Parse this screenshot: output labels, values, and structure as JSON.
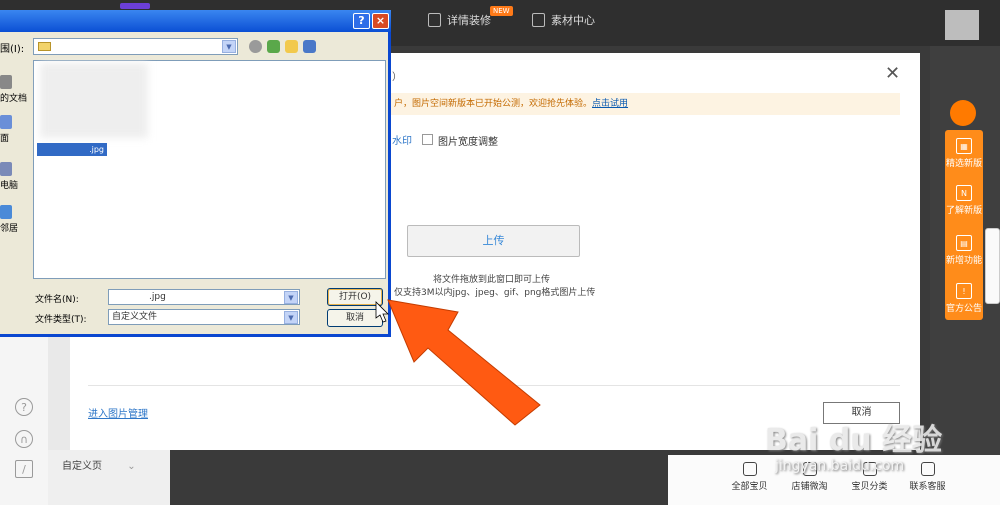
{
  "topbar": {
    "nav": [
      {
        "label": "详情装修",
        "badge": "NEW"
      },
      {
        "label": "素材中心"
      }
    ]
  },
  "left_gutter": {
    "item": "自定义页"
  },
  "right_sidebar": {
    "items": [
      "精选新版",
      "了解新版",
      "新增功能",
      "官方公告"
    ]
  },
  "bottom_bar": {
    "items": [
      "全部宝贝",
      "店铺微淘",
      "宝贝分类",
      "联系客服"
    ]
  },
  "modal": {
    "paren_text": "）",
    "notice_text": "户，图片空间新版本已开始公测，欢迎抢先体验。",
    "notice_link": "点击试用",
    "watermark_label": "水印",
    "checkbox_label": "图片宽度调整",
    "upload_label": "上传",
    "drag_hint": "将文件拖放到此窗口即可上传",
    "format_hint": "仅支持3M以内jpg、jpeg、gif、png格式图片上传",
    "manage_link": "进入图片管理",
    "cancel_label": "取消"
  },
  "file_dialog": {
    "lookin_label": "围(I):",
    "places": [
      "的文档",
      "面",
      "电脑",
      "邻居"
    ],
    "selected_file": ".jpg",
    "filename_label": "文件名(N):",
    "filename_value": ".jpg",
    "filetype_label": "文件类型(T):",
    "filetype_value": "自定义文件",
    "open_label": "打开(O)",
    "cancel_label": "取消"
  },
  "watermark": {
    "brand": "Bai du 经验",
    "url": "jingyan.baidu.com"
  }
}
